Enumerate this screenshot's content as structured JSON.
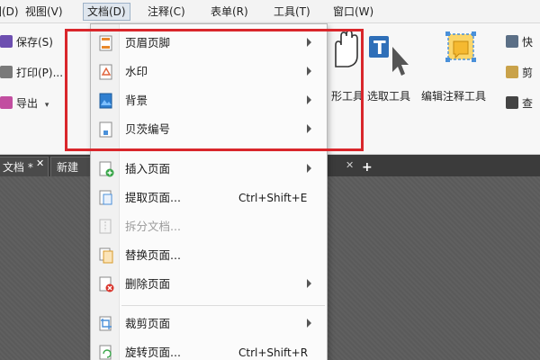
{
  "menubar": {
    "items": [
      {
        "label": "图(D)"
      },
      {
        "label": "视图(V)"
      },
      {
        "label": "文档(D)"
      },
      {
        "label": "注释(C)"
      },
      {
        "label": "表单(R)"
      },
      {
        "label": "工具(T)"
      },
      {
        "label": "窗口(W)"
      }
    ]
  },
  "ribbon": {
    "left_buttons": [
      {
        "label": "保存(S)",
        "icon": "save-icon"
      },
      {
        "label": "打印(P)...",
        "icon": "print-icon"
      },
      {
        "label": "导出",
        "icon": "export-icon"
      }
    ],
    "tools": [
      {
        "label": "形工具",
        "icon": "hand-icon"
      },
      {
        "label": "选取工具",
        "icon": "select-text-icon"
      },
      {
        "label": "编辑注释工具",
        "icon": "edit-annotation-icon"
      }
    ],
    "right_partial": [
      {
        "label": "快"
      },
      {
        "label": "剪"
      },
      {
        "label": "查"
      }
    ]
  },
  "tabs": [
    {
      "label": "文档 *"
    },
    {
      "label": "新建"
    }
  ],
  "document_menu": {
    "items": [
      {
        "label": "页眉页脚",
        "shortcut": "",
        "submenu": true,
        "disabled": false,
        "icon": "header-footer-icon"
      },
      {
        "label": "水印",
        "shortcut": "",
        "submenu": true,
        "disabled": false,
        "icon": "watermark-icon"
      },
      {
        "label": "背景",
        "shortcut": "",
        "submenu": true,
        "disabled": false,
        "icon": "background-icon"
      },
      {
        "label": "贝茨编号",
        "shortcut": "",
        "submenu": true,
        "disabled": false,
        "icon": "bates-numbering-icon"
      },
      {
        "label": "插入页面",
        "shortcut": "",
        "submenu": true,
        "disabled": false,
        "icon": "insert-page-icon"
      },
      {
        "label": "提取页面...",
        "shortcut": "Ctrl+Shift+E",
        "submenu": false,
        "disabled": false,
        "icon": "extract-page-icon"
      },
      {
        "label": "拆分文档...",
        "shortcut": "",
        "submenu": false,
        "disabled": true,
        "icon": "split-document-icon"
      },
      {
        "label": "替换页面...",
        "shortcut": "",
        "submenu": false,
        "disabled": false,
        "icon": "replace-page-icon"
      },
      {
        "label": "删除页面",
        "shortcut": "",
        "submenu": true,
        "disabled": false,
        "icon": "delete-page-icon"
      },
      {
        "label": "裁剪页面",
        "shortcut": "",
        "submenu": true,
        "disabled": false,
        "icon": "crop-page-icon"
      },
      {
        "label": "旋转页面...",
        "shortcut": "Ctrl+Shift+R",
        "submenu": false,
        "disabled": false,
        "icon": "rotate-page-icon"
      }
    ]
  },
  "colors": {
    "highlight": "#d9262b",
    "menu_bg": "#fbfbfb",
    "tab_strip": "#3b3b3b"
  }
}
